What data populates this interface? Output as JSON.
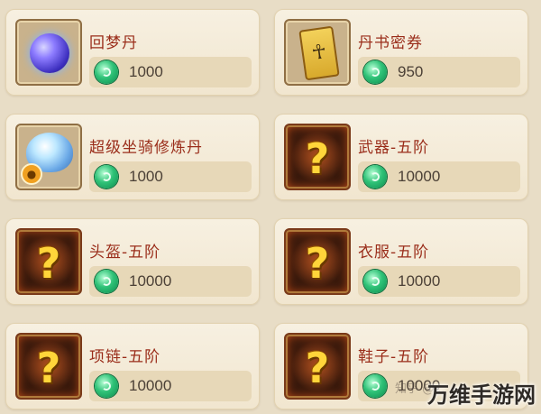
{
  "items": [
    {
      "name": "回梦丹",
      "price": "1000",
      "icon": "purple-orb-icon"
    },
    {
      "name": "丹书密券",
      "price": "950",
      "icon": "scroll-icon"
    },
    {
      "name": "超级坐骑修炼丹",
      "price": "1000",
      "icon": "crystal-pill-icon"
    },
    {
      "name": "武器-五阶",
      "price": "10000",
      "icon": "mystery-question-icon"
    },
    {
      "name": "头盔-五阶",
      "price": "10000",
      "icon": "mystery-question-icon"
    },
    {
      "name": "衣服-五阶",
      "price": "10000",
      "icon": "mystery-question-icon"
    },
    {
      "name": "项链-五阶",
      "price": "10000",
      "icon": "mystery-question-icon"
    },
    {
      "name": "鞋子-五阶",
      "price": "10000",
      "icon": "mystery-question-icon"
    }
  ],
  "mystery_symbol": "?",
  "scroll_glyph": "☥",
  "watermark": "万维手游网",
  "source_mark": "知乎 @...",
  "colors": {
    "title": "#9a2d1a",
    "price": "#4b4036",
    "card_bg": "#f4ead6",
    "currency": "#2fc277"
  }
}
